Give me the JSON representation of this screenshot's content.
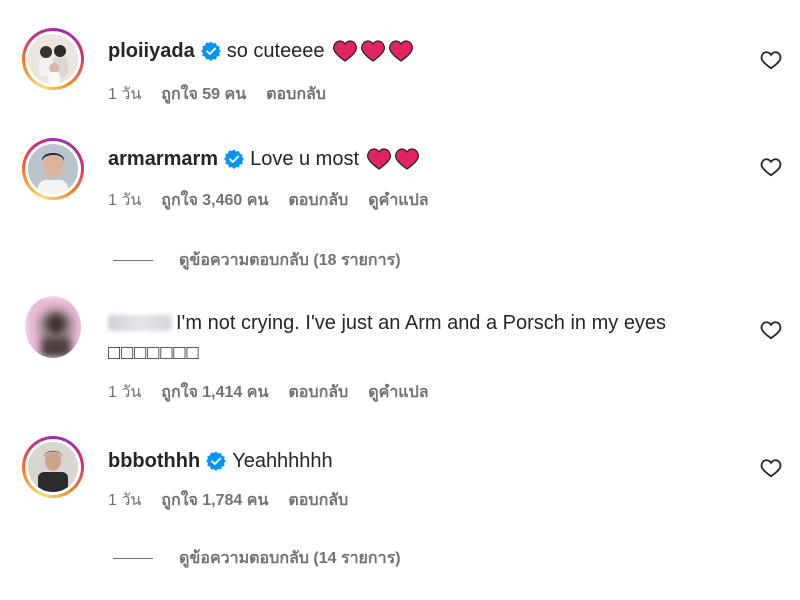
{
  "comments": [
    {
      "username": "ploiiyada",
      "verified": true,
      "text": "so cuteeee",
      "hearts": 3,
      "time": "1 วัน",
      "likes": "ถูกใจ 59 คน",
      "reply": "ตอบกลับ",
      "translate": ""
    },
    {
      "username": "armarmarm",
      "verified": true,
      "text": "Love u most",
      "hearts": 2,
      "time": "1 วัน",
      "likes": "ถูกใจ 3,460 คน",
      "reply": "ตอบกลับ",
      "translate": "ดูคำแปล",
      "view_replies": "ดูข้อความตอบกลับ (18 รายการ)"
    },
    {
      "username": "",
      "verified": false,
      "text": "I'm not crying. I've just an Arm and a Porsch in my eyes",
      "text2": "□□□□□□□",
      "time": "1 วัน",
      "likes": "ถูกใจ 1,414 คน",
      "reply": "ตอบกลับ",
      "translate": "ดูคำแปล"
    },
    {
      "username": "bbbothhh",
      "verified": true,
      "text": "Yeahhhhhh",
      "time": "1 วัน",
      "likes": "ถูกใจ 1,784 คน",
      "reply": "ตอบกลับ",
      "translate": "",
      "view_replies": "ดูข้อความตอบกลับ (14 รายการ)"
    }
  ],
  "colors": {
    "text": "#262626",
    "secondary": "#737373",
    "verified": "#0095f6",
    "heart_emoji": "#e0245e"
  },
  "icons": {
    "verified": "verified-badge-icon",
    "like": "heart-outline-icon",
    "emoji": "red-heart-emoji"
  }
}
